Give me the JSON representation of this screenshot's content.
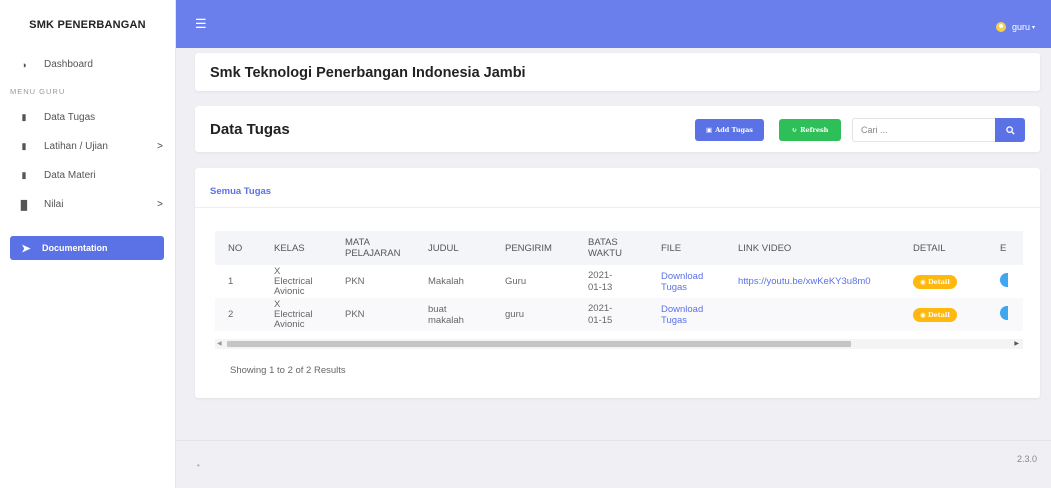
{
  "brand": "SMK PENERBANGAN",
  "sidebar": {
    "dashboard": "Dashboard",
    "section_title": "MENU GURU",
    "items": [
      {
        "label": "Data Tugas",
        "icon": "book-icon"
      },
      {
        "label": "Latihan / Ujian",
        "icon": "file-icon",
        "chevron": ">"
      },
      {
        "label": "Data Materi",
        "icon": "book-icon"
      },
      {
        "label": "Nilai",
        "icon": "chart-icon",
        "chevron": ">"
      }
    ],
    "documentation": "Documentation"
  },
  "topbar": {
    "user": "guru"
  },
  "header": {
    "title": "Smk Teknologi Penerbangan Indonesia Jambi"
  },
  "toolbar": {
    "title": "Data Tugas",
    "add_label": "Add Tugas",
    "refresh_label": "Refresh",
    "search_placeholder": "Cari ..."
  },
  "tab": "Semua Tugas",
  "table": {
    "headers": {
      "no": "NO",
      "kelas": "KELAS",
      "mapel_1": "MATA",
      "mapel_2": "PELAJARAN",
      "judul": "JUDUL",
      "pengirim": "PENGIRIM",
      "batas_1": "BATAS",
      "batas_2": "WAKTU",
      "file": "FILE",
      "link": "LINK VIDEO",
      "detail": "DETAIL",
      "extra": "E"
    },
    "rows": [
      {
        "no": "1",
        "kelas": [
          "X",
          "Electrical",
          "Avionic"
        ],
        "mapel": "PKN",
        "judul": [
          "Makalah",
          ""
        ],
        "pengirim": "Guru",
        "batas": [
          "2021-",
          "01-13"
        ],
        "file": [
          "Download",
          "Tugas"
        ],
        "link": "https://youtu.be/xwKeKY3u8m0",
        "detail": "Detail"
      },
      {
        "no": "2",
        "kelas": [
          "X",
          "Electrical",
          "Avionic"
        ],
        "mapel": "PKN",
        "judul": [
          "buat",
          "makalah"
        ],
        "pengirim": "guru",
        "batas": [
          "2021-",
          "01-15"
        ],
        "file": [
          "Download",
          "Tugas"
        ],
        "link": "",
        "detail": "Detail"
      }
    ]
  },
  "showing": "Showing 1 to 2 of 2 Results",
  "footer": {
    "version": "2.3.0"
  }
}
